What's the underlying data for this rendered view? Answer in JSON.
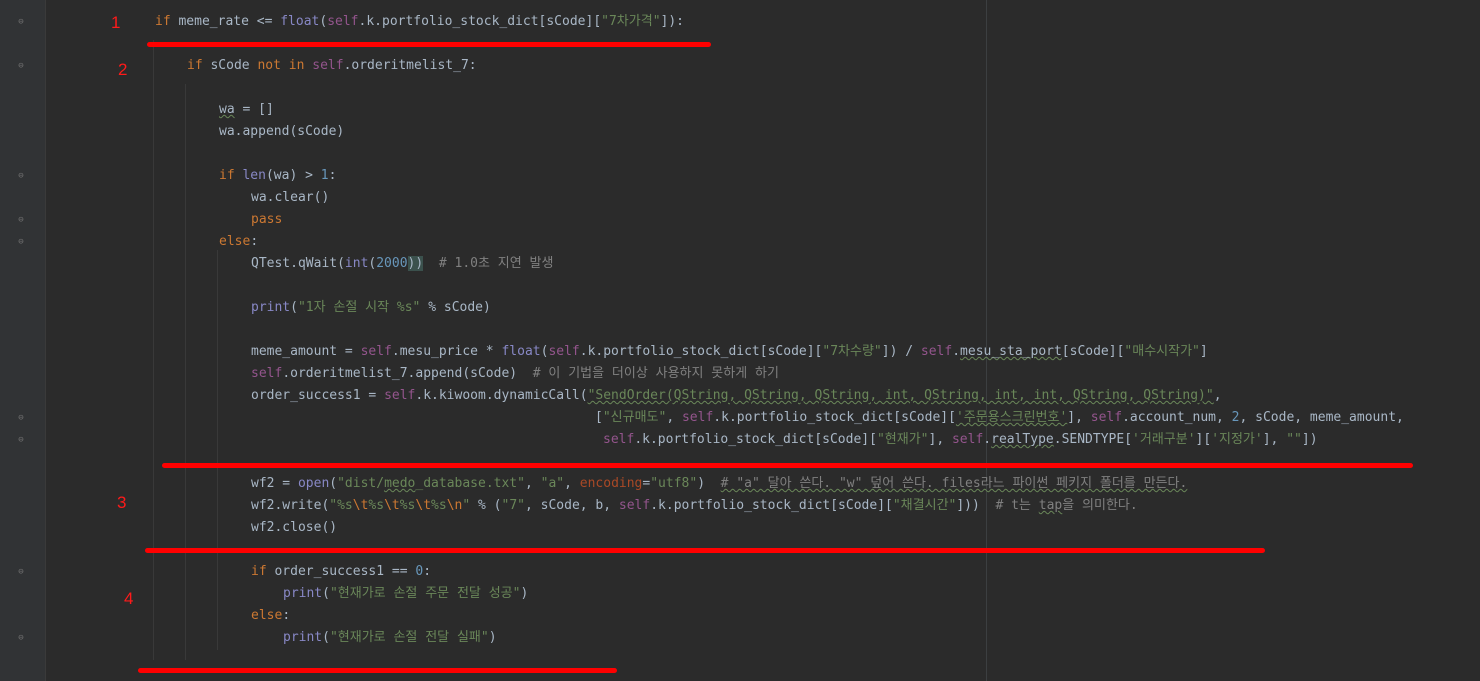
{
  "annotations": {
    "n1": "1",
    "n2": "2",
    "n3": "3",
    "n4": "4"
  },
  "code": {
    "l1": {
      "a": "if ",
      "b": "meme_rate <= ",
      "c": "float",
      "d": "(",
      "e": "self",
      ".f": ".k.portfolio_stock_dict[sCode][",
      "g": "\"7차가격\"",
      "h": "]):"
    },
    "l2": {
      "a": "if ",
      "b": "sCode ",
      "c": "not in ",
      "d": "self",
      "e": ".orderitmelist_7:"
    },
    "l3": {
      "a": "wa",
      " b": " = []"
    },
    "l4": {
      "a": "wa.append(sCode)"
    },
    "l5": {
      "a": "if ",
      "b": "len",
      "c": "(wa) > ",
      "d": "1",
      ".e": ":"
    },
    "l6": {
      "a": "wa.clear()"
    },
    "l7": {
      "a": "pass"
    },
    "l8": {
      "a": "else",
      ".b": ":"
    },
    "l9": {
      "a": "QTest.qWait(",
      "b": "int",
      "c": "(",
      "d": "2000",
      "e": "))",
      "f": "  # 1.0초 지연 발생"
    },
    "l10": {
      "a": "print",
      "b": "(",
      "c": "\"1자 손절 시작 %s\"",
      "d": " % sCode)"
    },
    "l11": {
      "a": "meme_amount = ",
      "b": "self",
      "c": ".mesu_price * ",
      "d": "float",
      "e": "(",
      "f": "self",
      "g": ".k.portfolio_stock_dict[sCode][",
      "h": "\"7차수량\"",
      "i": "]) / ",
      "j": "self",
      "k": ".",
      "l": "mesu_sta_port",
      "m": "[sCode][",
      "n": "\"매수시작가\"",
      "o": "]"
    },
    "l12": {
      "a": "self",
      "b": ".orderitmelist_7.append(sCode)",
      "c": "  # 이 기법을 더이상 사용하지 못하게 하기"
    },
    "l13": {
      "a": "order_success1 = ",
      "b": "self",
      "c": ".k.kiwoom.dynamicCall(",
      "d": "\"SendOrder(QString, QString, QString, int, QString, int, int, QString, QString)\"",
      ".e": ","
    },
    "l14": {
      "a": "[",
      "b": "\"신규매도\"",
      "c": ", ",
      "d": "self",
      "e": ".k.portfolio_stock_dict[sCode][",
      "f": "'주문용스크린번호'",
      "g": "], ",
      "h": "self",
      "i": ".account_num, ",
      "j": "2",
      "k": ", sCode, meme_amount,"
    },
    "l15": {
      "a": "self",
      "b": ".k.portfolio_stock_dict[sCode][",
      "c": "\"현재가\"",
      "d": "], ",
      "e": "self",
      "f": ".",
      "g": "realType",
      "h": ".SENDTYPE[",
      "i": "'거래구분'",
      "j": "][",
      "k": "'지정가'",
      "l": "], ",
      "m": "\"\"",
      "n": "])"
    },
    "l16": {
      "a": "wf2 = ",
      "b": "open",
      "c": "(",
      "d": "\"dist/",
      "e": "medo",
      "f": "_database.txt\"",
      "g": ", ",
      "h": "\"a\"",
      "i": ", ",
      "j": "encoding",
      "k": "=",
      "l": "\"utf8\"",
      "m": ")  ",
      "n": "# \"a\" 달아 쓴다. \"w\" 덮어 쓴다. files라느 파이썬 페키지 폴더를 만든다."
    },
    "l17": {
      "a": "wf2.write(",
      "b": "\"%s",
      "c": "\\t",
      "d": "%s",
      "e": "\\t",
      "f": "%s",
      "g": "\\t",
      "h": "%s",
      "i": "\\n",
      "j": "\"",
      "k": " % (",
      "l": "\"7\"",
      "m": ", sCode, b, ",
      "n": "self",
      "o": ".k.portfolio_stock_dict[sCode][",
      "p": "\"채결시간\"",
      "q": "]))  ",
      "r": "# t는 ",
      "s": "tap",
      "t": "을 의미한다."
    },
    "l18": {
      "a": "wf2.close()"
    },
    "l19": {
      "a": "if ",
      "b": "order_success1 == ",
      "c": "0",
      "d": ":"
    },
    "l20": {
      "a": "print",
      "b": "(",
      "c": "\"현재가로 손절 주문 전달 성공\"",
      "d": ")"
    },
    "l21": {
      "a": "else",
      ".b": ":"
    },
    "l22": {
      "a": "print",
      "b": "(",
      "c": "\"현재가로 손절 전달 실패\"",
      "d": ")"
    }
  }
}
